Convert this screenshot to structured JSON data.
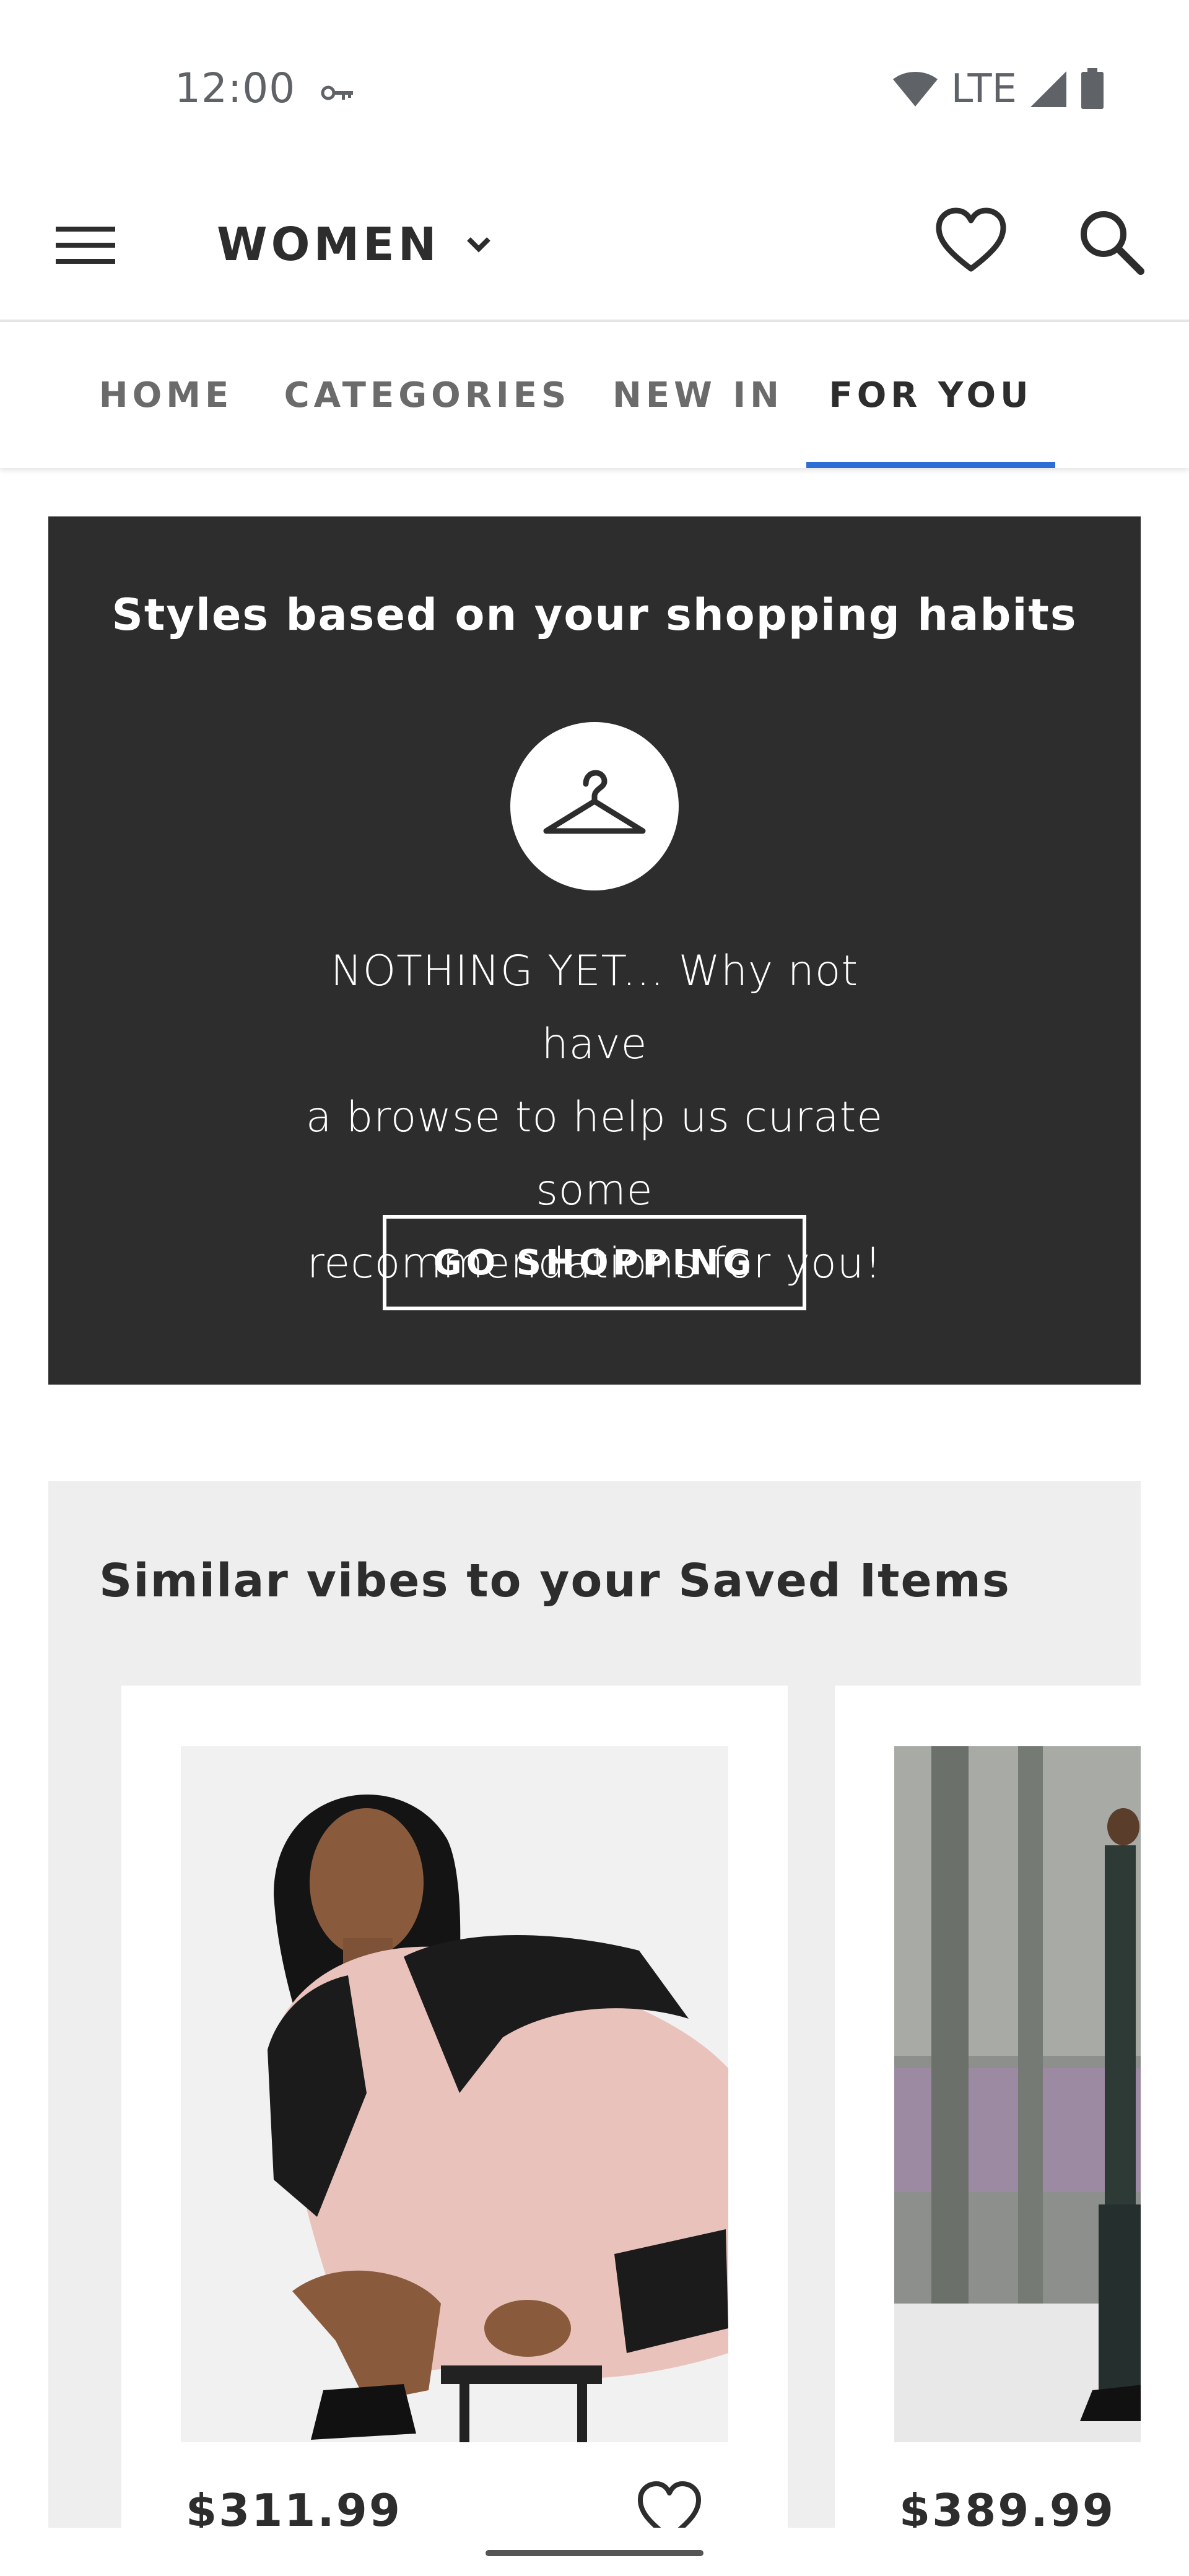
{
  "status_bar": {
    "time": "12:00",
    "network": "LTE",
    "icons": [
      "vpn-key-icon",
      "wifi-icon",
      "cell-signal-icon",
      "battery-icon"
    ]
  },
  "header": {
    "gender": "WOMEN",
    "icons": [
      "menu-icon",
      "chevron-down-icon",
      "heart-icon",
      "search-icon"
    ]
  },
  "tabs": [
    {
      "label": "HOME",
      "active": false
    },
    {
      "label": "CATEGORIES",
      "active": false
    },
    {
      "label": "NEW IN",
      "active": false
    },
    {
      "label": "FOR YOU",
      "active": true
    }
  ],
  "banner": {
    "title": "Styles based on your shopping habits",
    "icon": "hanger-icon",
    "message_lines": [
      "NOTHING YET... Why not have",
      "a browse to help us curate some",
      "recommendations for you!"
    ],
    "button_label": "GO SHOPPING"
  },
  "similar": {
    "title": "Similar vibes to your Saved Items",
    "products": [
      {
        "price": "$311.99"
      },
      {
        "price": "$389.99"
      }
    ]
  },
  "colors": {
    "banner_bg": "#2d2d2d",
    "tab_indicator": "#2d6ed6",
    "section_bg": "#eeeeee",
    "text": "#2d2d2d"
  }
}
